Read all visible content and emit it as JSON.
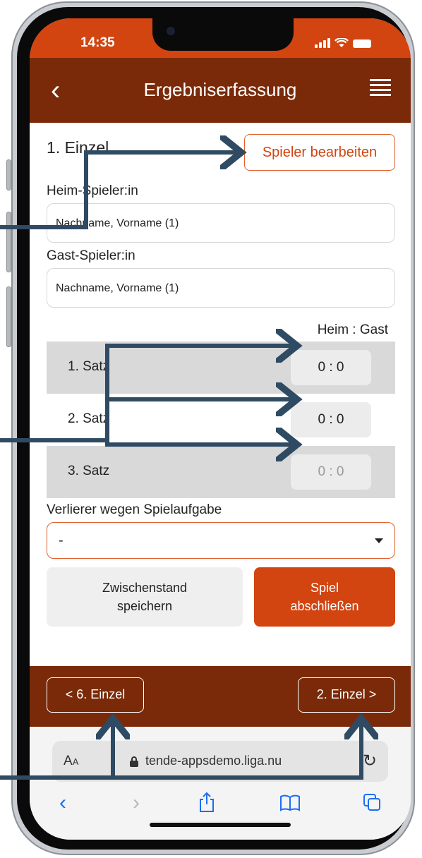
{
  "status": {
    "time": "14:35"
  },
  "header": {
    "title": "Ergebniserfassung"
  },
  "match": {
    "title": "1. Einzel",
    "edit_button": "Spieler bearbeiten",
    "home_label": "Heim-Spieler:in",
    "home_value": "Nachname, Vorname (1)",
    "guest_label": "Gast-Spieler:in",
    "guest_value": "Nachname, Vorname (1)",
    "score_header": "Heim : Gast"
  },
  "sets": [
    {
      "label": "1. Satz",
      "score": "0 : 0"
    },
    {
      "label": "2. Satz",
      "score": "0 : 0"
    },
    {
      "label": "3. Satz",
      "score": "0 : 0"
    }
  ],
  "forfeit": {
    "label": "Verlierer wegen Spielaufgabe",
    "value": "-"
  },
  "actions": {
    "interim_line1": "Zwischenstand",
    "interim_line2": "speichern",
    "finish_line1": "Spiel",
    "finish_line2": "abschließen"
  },
  "nav": {
    "prev": "< 6. Einzel",
    "next": "2. Einzel >"
  },
  "browser": {
    "aa_big": "A",
    "aa_small": "A",
    "url": "tende-appsdemo.liga.nu"
  },
  "colors": {
    "brand_orange": "#d24410",
    "brand_dark": "#7a2a08",
    "annotation_arrow": "#2f4a63"
  }
}
